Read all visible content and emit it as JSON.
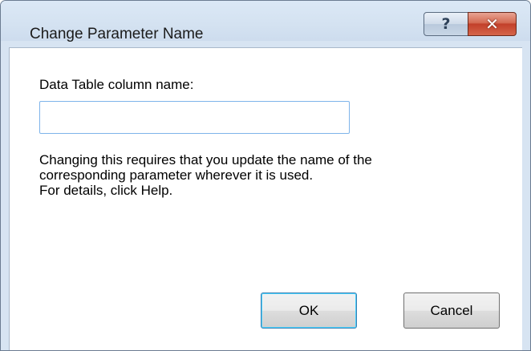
{
  "window": {
    "title": "Change Parameter Name",
    "help_glyph": "?",
    "close_glyph": "✕"
  },
  "form": {
    "field_label": "Data Table column name:",
    "field_value": "",
    "field_placeholder": ""
  },
  "info": {
    "line1": "Changing this requires that you update the name of the",
    "line2": "corresponding parameter wherever it is used.",
    "line3": "For details, click Help."
  },
  "buttons": {
    "ok_label": "OK",
    "cancel_label": "Cancel"
  },
  "icons": {
    "help": "help-icon",
    "close": "close-icon"
  },
  "colors": {
    "close_button": "#c2402a",
    "input_border": "#7eb4ea",
    "default_button_border": "#3c7fb1"
  }
}
